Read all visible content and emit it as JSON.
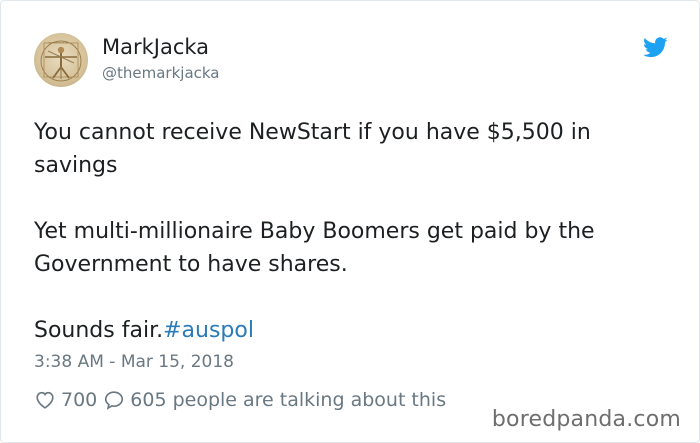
{
  "tweet": {
    "author": {
      "name": "MarkJacka",
      "handle": "@themarkjacka",
      "avatar_icon": "vitruvian-man-avatar"
    },
    "brand_icon": "twitter-bird-icon",
    "paragraphs": [
      "You cannot receive NewStart if you have $5,500 in savings",
      "Yet multi-millionaire Baby Boomers get paid by the Government to have shares."
    ],
    "closing_text": "Sounds fair.",
    "hashtag": "#auspol",
    "timestamp": "3:38 AM - Mar 15, 2018",
    "likes_count": "700",
    "talking_text": "605 people are talking about this"
  },
  "watermark": "boredpanda.com",
  "colors": {
    "text": "#1c2022",
    "muted": "#697882",
    "link": "#2b7bb9",
    "twitter_blue": "#1da1f2"
  }
}
